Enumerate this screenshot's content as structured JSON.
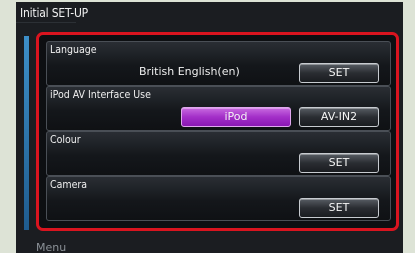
{
  "screen": {
    "title": "Initial SET-UP",
    "menu_label": "Menu"
  },
  "settings": [
    {
      "label": "Language",
      "value": "British English(en)",
      "button": "SET"
    },
    {
      "label": "iPod AV Interface Use",
      "options": [
        "iPod",
        "AV-IN2"
      ],
      "selected": "iPod"
    },
    {
      "label": "Colour",
      "button": "SET"
    },
    {
      "label": "Camera",
      "button": "SET"
    }
  ],
  "colors": {
    "highlight_border": "#d9141f",
    "active_button": "#a32fc8",
    "accent_bar": "#3d8fc8"
  }
}
